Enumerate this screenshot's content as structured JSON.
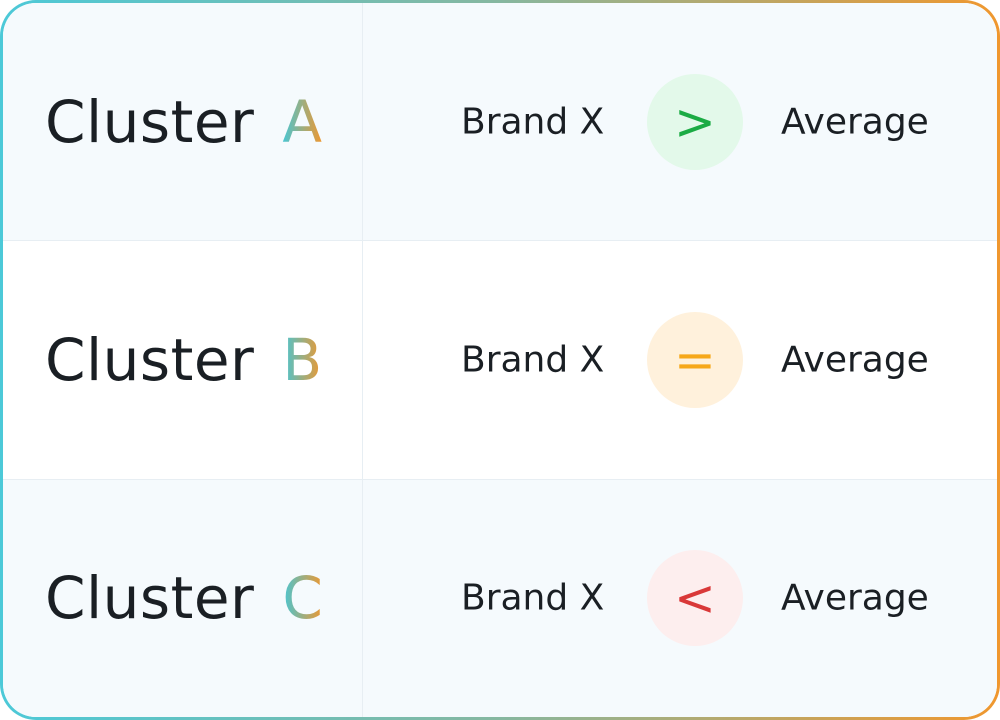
{
  "rows": [
    {
      "cluster_label": "Cluster",
      "letter": "A",
      "left_text": "Brand X",
      "operator": ">",
      "right_text": "Average",
      "operator_color": "#1bab44"
    },
    {
      "cluster_label": "Cluster",
      "letter": "B",
      "left_text": "Brand X",
      "operator": "=",
      "right_text": "Average",
      "operator_color": "#f6a81a"
    },
    {
      "cluster_label": "Cluster",
      "letter": "C",
      "left_text": "Brand X",
      "operator": "<",
      "right_text": "Average",
      "operator_color": "#d93838"
    }
  ],
  "colors": {
    "gradient_start": "#4cc9d8",
    "gradient_end": "#f0972e"
  }
}
